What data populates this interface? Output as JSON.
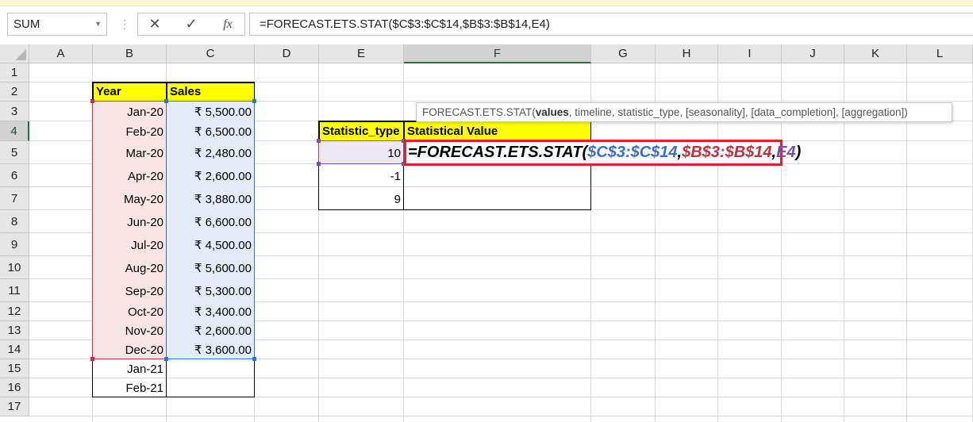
{
  "name_box": {
    "value": "SUM",
    "dropdown": "chevron-down-icon"
  },
  "formula_bar": {
    "cancel_glyph": "✕",
    "enter_glyph": "✓",
    "fx_glyph": "fx",
    "content": "=FORECAST.ETS.STAT($C$3:$C$14,$B$3:$B$14,E4)"
  },
  "columns": [
    "A",
    "B",
    "C",
    "D",
    "E",
    "F",
    "G",
    "H",
    "I",
    "J",
    "K",
    "L"
  ],
  "rows": [
    "1",
    "2",
    "3",
    "4",
    "5",
    "6",
    "7",
    "8",
    "9",
    "10",
    "11",
    "12",
    "13",
    "14",
    "15",
    "16",
    "17"
  ],
  "table1": {
    "headers": {
      "year": "Year",
      "sales": "Sales"
    },
    "years": [
      "Jan-20",
      "Feb-20",
      "Mar-20",
      "Apr-20",
      "May-20",
      "Jun-20",
      "Jul-20",
      "Aug-20",
      "Sep-20",
      "Oct-20",
      "Nov-20",
      "Dec-20",
      "Jan-21",
      "Feb-21"
    ],
    "sales": [
      "₹ 5,500.00",
      "₹ 6,500.00",
      "₹ 2,480.00",
      "₹ 2,600.00",
      "₹ 3,880.00",
      "₹ 6,600.00",
      "₹ 4,500.00",
      "₹ 5,600.00",
      "₹ 5,300.00",
      "₹ 3,400.00",
      "₹ 2,600.00",
      "₹ 3,600.00"
    ]
  },
  "table2": {
    "headers": {
      "statistic_type": "Statistic_type",
      "statistical_value": "Statistical Value"
    },
    "types": [
      "10",
      "-1",
      "9"
    ]
  },
  "edit_formula": {
    "prefix": "=FORECAST.ETS.STAT(",
    "arg1": "$C$3:$C$14",
    "sep1": ",",
    "arg2": "$B$3:$B$14",
    "sep2": ",",
    "arg3": "E4",
    "suffix": ")"
  },
  "tooltip": {
    "fn": "FORECAST.ETS.STAT(",
    "bold_arg": "values",
    "rest": ", timeline, statistic_type, [seasonality], [data_completion], [aggregation])"
  },
  "colors": {
    "arg1": "#3b6fc4",
    "arg2": "#c0313f",
    "arg3": "#7a4fb0",
    "highlight_border": "#e0202a",
    "header_fill": "#ffff00"
  }
}
